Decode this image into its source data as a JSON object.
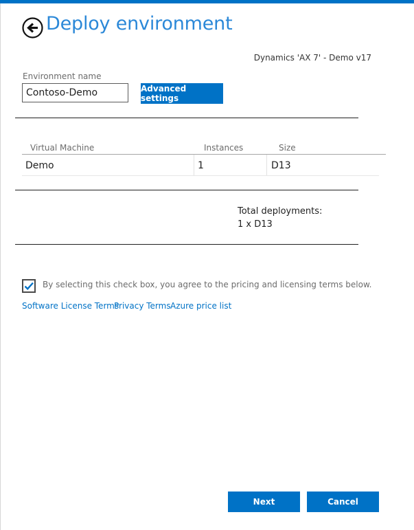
{
  "header": {
    "title": "Deploy environment",
    "product": "Dynamics 'AX 7' - Demo v17"
  },
  "environment": {
    "label": "Environment name",
    "value": "Contoso-Demo",
    "advanced_label": "Advanced settings"
  },
  "vm_table": {
    "columns": [
      "Virtual Machine",
      "Instances",
      "Size"
    ],
    "rows": [
      {
        "virtual_machine": "Demo",
        "instances": "1",
        "size": "D13"
      }
    ]
  },
  "totals": {
    "label": "Total deployments:",
    "value": "1 x D13"
  },
  "agreement": {
    "checked": true,
    "text": "By selecting this check box, you agree to the pricing and licensing terms below."
  },
  "links": [
    "Software License Terms",
    "Privacy Terms",
    "Azure price list"
  ],
  "footer": {
    "next_label": "Next",
    "cancel_label": "Cancel"
  },
  "colors": {
    "accent": "#0072c6",
    "title": "#2b88d8"
  }
}
